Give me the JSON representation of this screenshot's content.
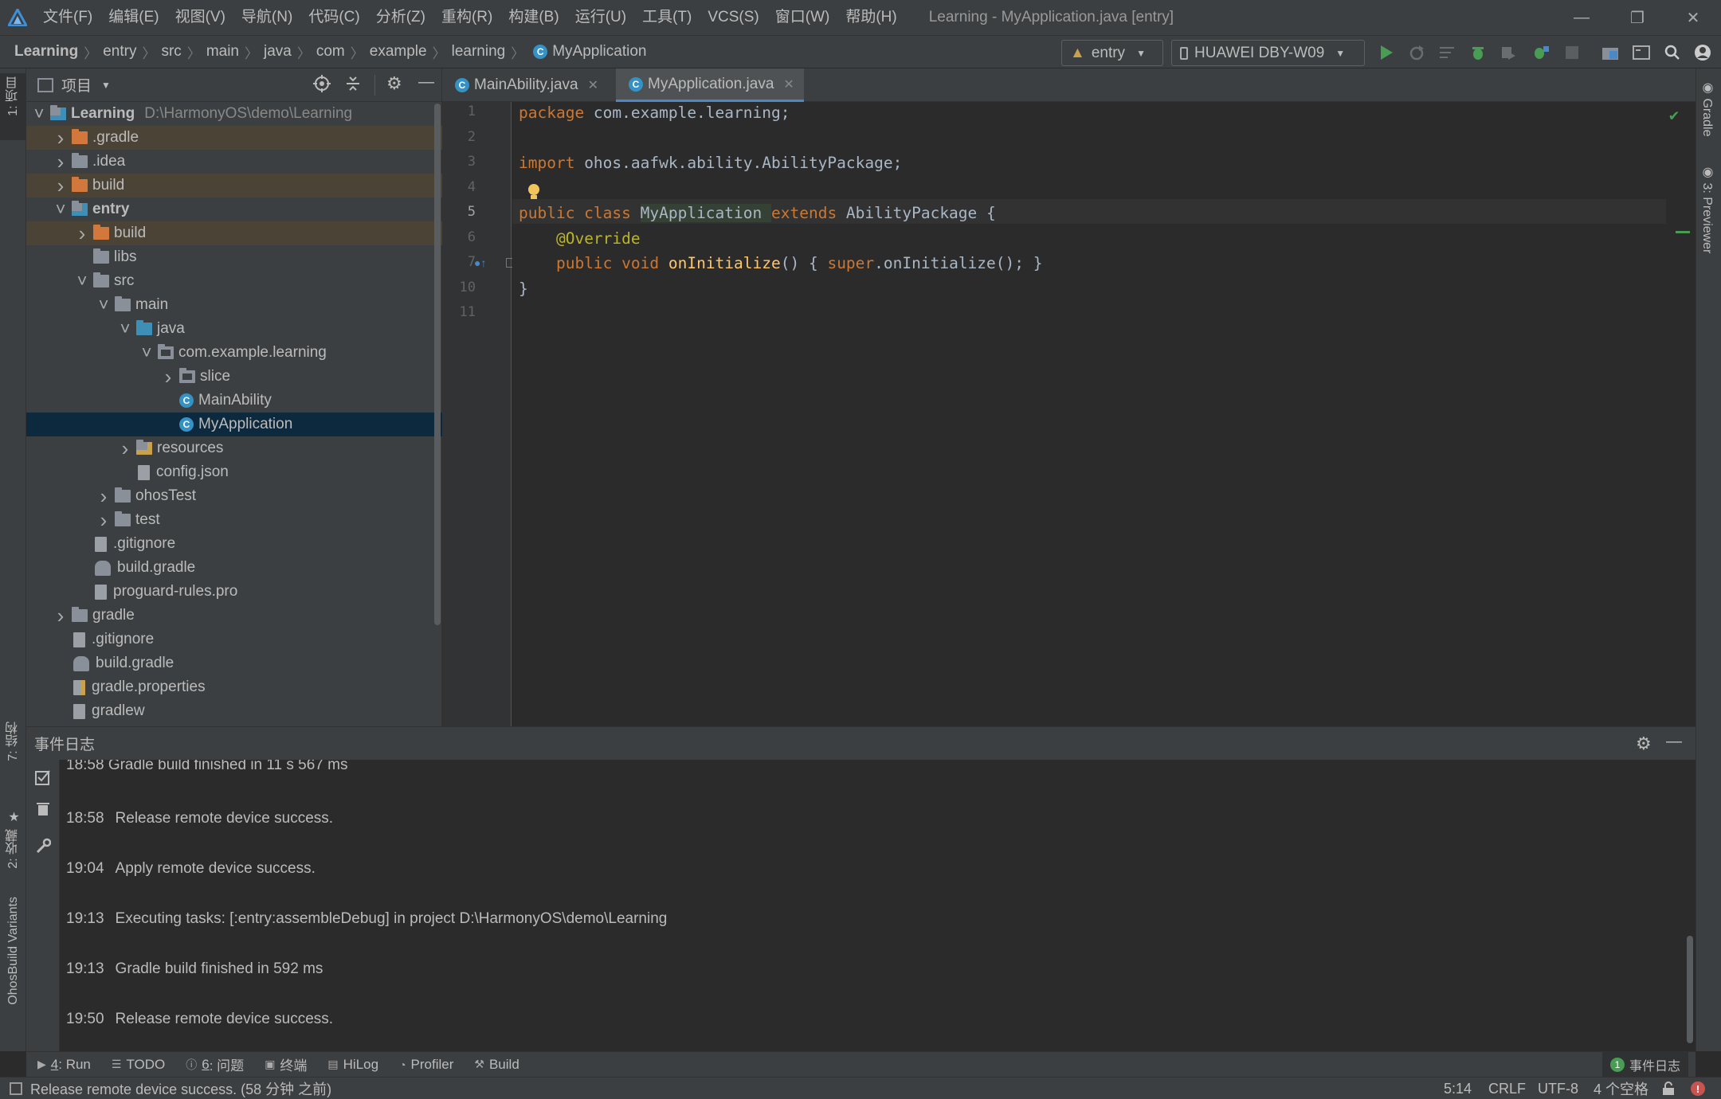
{
  "app": {
    "window_title": "Learning - MyApplication.java [entry]",
    "menu": [
      "文件(F)",
      "编辑(E)",
      "视图(V)",
      "导航(N)",
      "代码(C)",
      "分析(Z)",
      "重构(R)",
      "构建(B)",
      "运行(U)",
      "工具(T)",
      "VCS(S)",
      "窗口(W)",
      "帮助(H)"
    ]
  },
  "breadcrumb": [
    "Learning",
    "entry",
    "src",
    "main",
    "java",
    "com",
    "example",
    "learning",
    "MyApplication"
  ],
  "toolbar": {
    "module_combo": "entry",
    "device_combo": "HUAWEI DBY-W09"
  },
  "left_stripe": {
    "project_tab": "1: 项目",
    "structure_tab": "7: 结构",
    "favorites_tab": "2: 收藏",
    "build_variants_tab": "OhosBuild Variants"
  },
  "right_stripe": {
    "gradle_tab": "Gradle",
    "previewer_tab": "3: Previewer"
  },
  "project_panel": {
    "title": "项目",
    "tree": [
      {
        "label": "Learning",
        "suffix": "D:\\HarmonyOS\\demo\\Learning",
        "depth": 0,
        "state": "open",
        "icon": "module-folder",
        "bold": true
      },
      {
        "label": ".gradle",
        "depth": 1,
        "state": "closed",
        "icon": "orange-folder",
        "hl": true
      },
      {
        "label": ".idea",
        "depth": 1,
        "state": "closed",
        "icon": "folder"
      },
      {
        "label": "build",
        "depth": 1,
        "state": "closed",
        "icon": "orange-folder",
        "hl": true
      },
      {
        "label": "entry",
        "depth": 1,
        "state": "open",
        "icon": "module-folder",
        "bold": true
      },
      {
        "label": "build",
        "depth": 2,
        "state": "closed",
        "icon": "orange-folder",
        "hl": true
      },
      {
        "label": "libs",
        "depth": 2,
        "state": "none",
        "icon": "folder"
      },
      {
        "label": "src",
        "depth": 2,
        "state": "open",
        "icon": "folder"
      },
      {
        "label": "main",
        "depth": 3,
        "state": "open",
        "icon": "folder"
      },
      {
        "label": "java",
        "depth": 4,
        "state": "open",
        "icon": "blue-folder"
      },
      {
        "label": "com.example.learning",
        "depth": 5,
        "state": "open",
        "icon": "package"
      },
      {
        "label": "slice",
        "depth": 6,
        "state": "closed",
        "icon": "package"
      },
      {
        "label": "MainAbility",
        "depth": 6,
        "state": "none",
        "icon": "class"
      },
      {
        "label": "MyApplication",
        "depth": 6,
        "state": "none",
        "icon": "class",
        "selected": true
      },
      {
        "label": "resources",
        "depth": 4,
        "state": "closed",
        "icon": "res-folder"
      },
      {
        "label": "config.json",
        "depth": 4,
        "state": "none",
        "icon": "json-file"
      },
      {
        "label": "ohosTest",
        "depth": 3,
        "state": "closed",
        "icon": "folder"
      },
      {
        "label": "test",
        "depth": 3,
        "state": "closed",
        "icon": "folder"
      },
      {
        "label": ".gitignore",
        "depth": 2,
        "state": "none",
        "icon": "file"
      },
      {
        "label": "build.gradle",
        "depth": 2,
        "state": "none",
        "icon": "gradle-file"
      },
      {
        "label": "proguard-rules.pro",
        "depth": 2,
        "state": "none",
        "icon": "file"
      },
      {
        "label": "gradle",
        "depth": 1,
        "state": "closed",
        "icon": "folder"
      },
      {
        "label": ".gitignore",
        "depth": 1,
        "state": "none",
        "icon": "file"
      },
      {
        "label": "build.gradle",
        "depth": 1,
        "state": "none",
        "icon": "gradle-file"
      },
      {
        "label": "gradle.properties",
        "depth": 1,
        "state": "none",
        "icon": "props-file"
      },
      {
        "label": "gradlew",
        "depth": 1,
        "state": "none",
        "icon": "exec-file"
      }
    ]
  },
  "editor": {
    "tabs": [
      {
        "label": "MainAbility.java",
        "active": false
      },
      {
        "label": "MyApplication.java",
        "active": true
      }
    ],
    "line_numbers": [
      "1",
      "2",
      "3",
      "4",
      "5",
      "6",
      "7",
      "10",
      "11"
    ],
    "code": [
      {
        "ln": "1",
        "tokens": [
          [
            "kw",
            "package "
          ],
          [
            "plain",
            "com.example.learning;"
          ]
        ]
      },
      {
        "ln": "2",
        "tokens": []
      },
      {
        "ln": "3",
        "tokens": [
          [
            "kw",
            "import "
          ],
          [
            "plain",
            "ohos.aafwk.ability.AbilityPackage;"
          ]
        ]
      },
      {
        "ln": "4",
        "tokens": []
      },
      {
        "ln": "5",
        "tokens": [
          [
            "kw",
            "public class "
          ],
          [
            "plain",
            "MyApplication "
          ],
          [
            "kw",
            "extends "
          ],
          [
            "plain",
            "AbilityPackage {"
          ]
        ]
      },
      {
        "ln": "6",
        "tokens": [
          [
            "plain",
            "    "
          ],
          [
            "ann",
            "@Override"
          ]
        ]
      },
      {
        "ln": "7",
        "tokens": [
          [
            "plain",
            "    "
          ],
          [
            "kw",
            "public void "
          ],
          [
            "fn",
            "onInitialize"
          ],
          [
            "plain",
            "() { "
          ],
          [
            "kw",
            "super"
          ],
          [
            "plain",
            ".onInitialize(); }"
          ]
        ]
      },
      {
        "ln": "10",
        "tokens": [
          [
            "plain",
            "}"
          ]
        ]
      },
      {
        "ln": "11",
        "tokens": []
      }
    ]
  },
  "event_log": {
    "title": "事件日志",
    "partial_first": "18:58  Gradle build finished in 11 s 567 ms",
    "entries": [
      {
        "time": "18:58",
        "text": "Release remote device success."
      },
      {
        "time": "19:04",
        "text": "Apply remote device success."
      },
      {
        "time": "19:13",
        "text": "Executing tasks: [:entry:assembleDebug] in project D:\\HarmonyOS\\demo\\Learning"
      },
      {
        "time": "19:13",
        "text": "Gradle build finished in 592 ms"
      },
      {
        "time": "19:50",
        "text": "Release remote device success."
      }
    ]
  },
  "bottom_tools": [
    {
      "num": "4",
      "label": ": Run",
      "icon": "run-icon"
    },
    {
      "num": "",
      "label": "TODO",
      "icon": "todo-icon"
    },
    {
      "num": "6",
      "label": ": 问题",
      "icon": "problems-icon"
    },
    {
      "num": "",
      "label": "终端",
      "icon": "terminal-icon"
    },
    {
      "num": "",
      "label": "HiLog",
      "icon": "hilog-icon"
    },
    {
      "num": "",
      "label": "Profiler",
      "icon": "profiler-icon"
    },
    {
      "num": "",
      "label": "Build",
      "icon": "build-icon"
    }
  ],
  "event_log_button": {
    "badge": "1",
    "label": "事件日志"
  },
  "status": {
    "message": "Release remote device success. (58 分钟 之前)",
    "position": "5:14",
    "line_sep": "CRLF",
    "encoding": "UTF-8",
    "indent": "4 个空格"
  },
  "colors": {
    "accent": "#4a88c7",
    "run_green": "#499c54",
    "selection": "#0d293e",
    "ignored_highlight": "#4b4436"
  }
}
